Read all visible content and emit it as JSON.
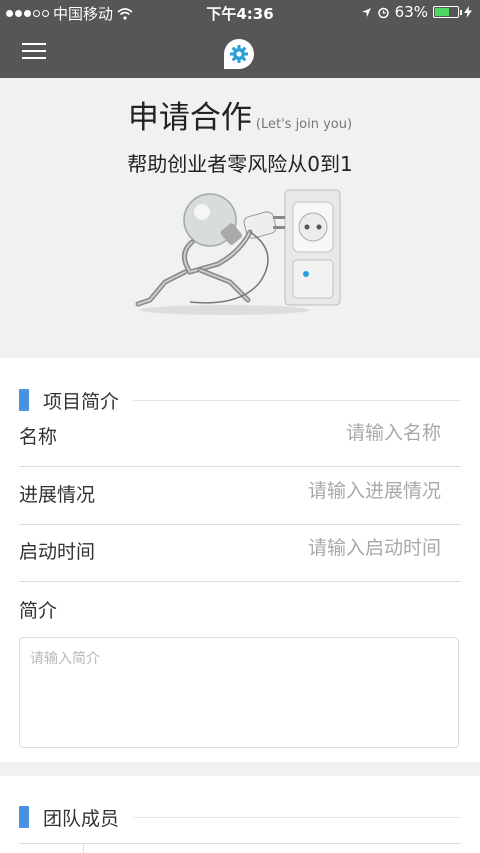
{
  "status_bar": {
    "carrier": "中国移动",
    "time": "下午4:36",
    "battery": "63%",
    "battery_level": 0.63,
    "icons": [
      "signal-icon",
      "wifi-icon",
      "location-icon",
      "alarm-icon",
      "battery-icon",
      "charging-icon"
    ]
  },
  "navbar": {
    "menu_icon": "hamburger-icon",
    "logo_icon": "gear-logo-icon"
  },
  "hero": {
    "title": "申请合作",
    "title_en": "(Let's join you)",
    "subtitle": "帮助创业者零风险从0到1",
    "image": "lightbulb-robot-plug-illustration"
  },
  "project_section": {
    "title": "项目简介",
    "fields": [
      {
        "label": "名称",
        "placeholder": "请输入名称",
        "value": ""
      },
      {
        "label": "进展情况",
        "placeholder": "请输入进展情况",
        "value": ""
      },
      {
        "label": "启动时间",
        "placeholder": "请输入启动时间",
        "value": ""
      }
    ],
    "intro_label": "简介",
    "intro_placeholder": "请输入简介"
  },
  "team_section": {
    "title": "团队成员"
  },
  "colors": {
    "nav_bg": "#565656",
    "accent": "#4a90e2",
    "battery": "#4cd964",
    "page_bg": "#f1f1f1"
  }
}
